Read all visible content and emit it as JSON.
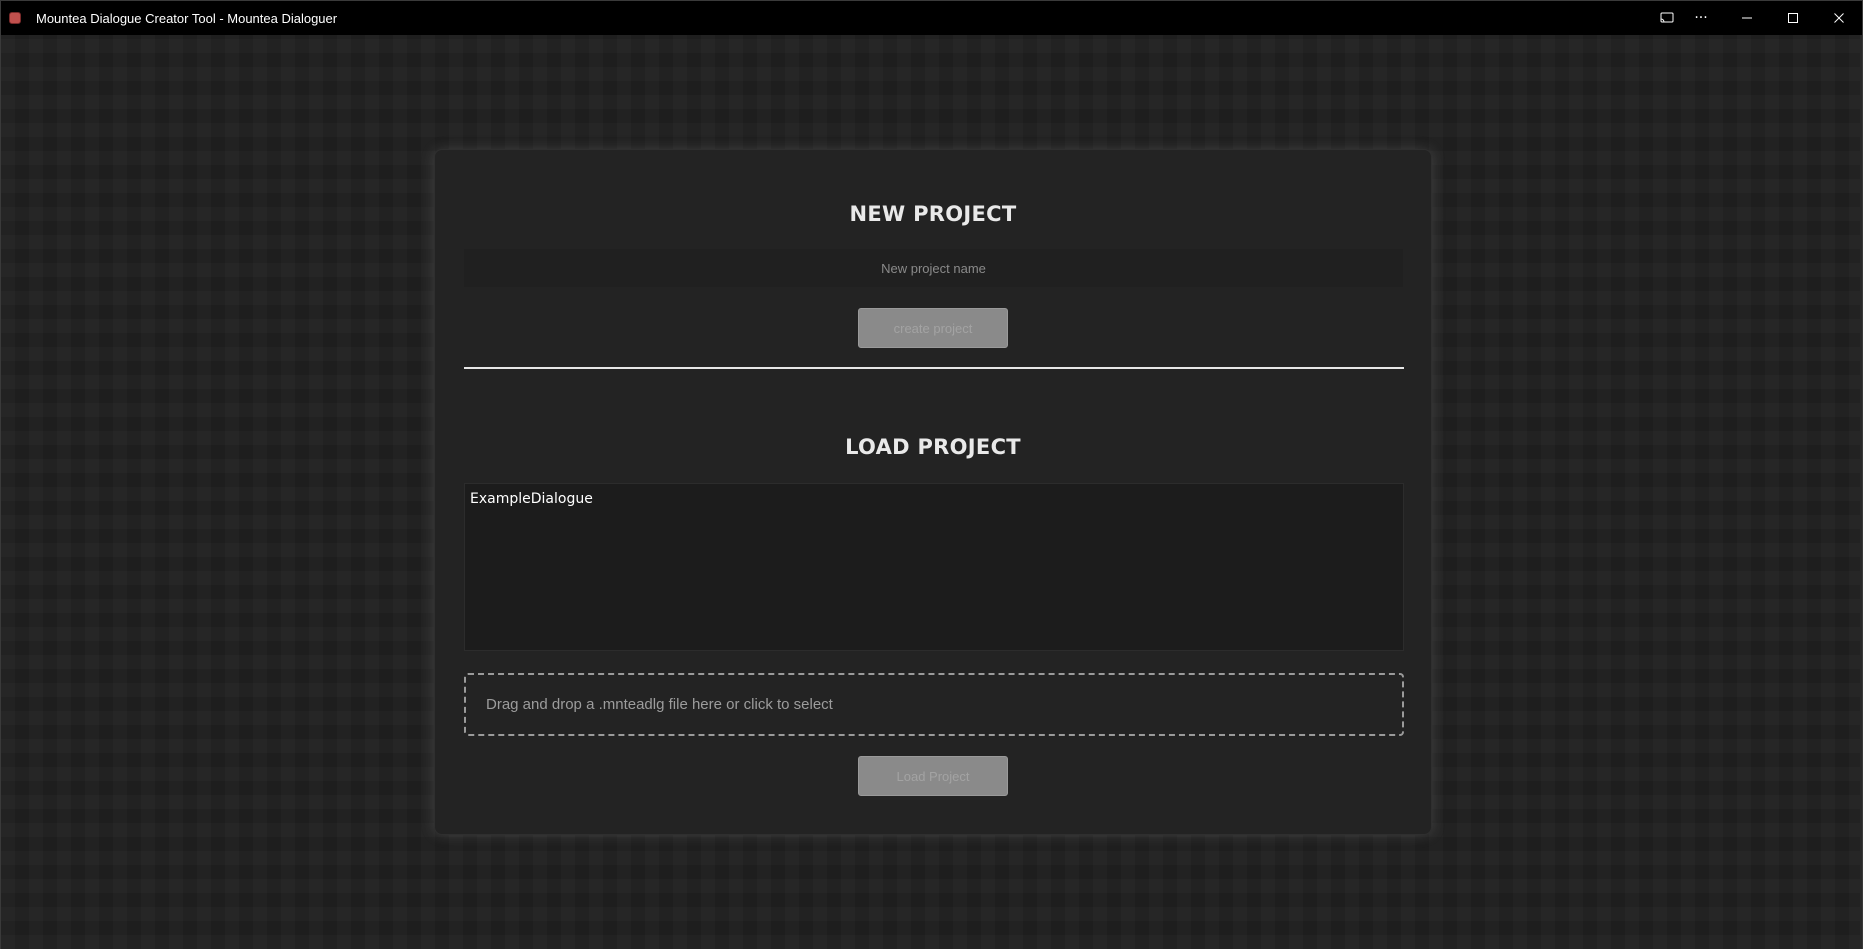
{
  "window": {
    "title": "Mountea Dialogue Creator Tool - Mountea Dialoguer",
    "controls": {
      "cast": "⧉",
      "more": "···",
      "minimize": "—",
      "maximize": "☐",
      "close": "✕"
    }
  },
  "new_project": {
    "heading": "NEW PROJECT",
    "name_placeholder": "New project name",
    "name_value": "",
    "create_label": "create project"
  },
  "load_project": {
    "heading": "LOAD PROJECT",
    "projects": [
      "ExampleDialogue"
    ],
    "dropzone_text": "Drag and drop a .mnteadlg file here or click to select",
    "load_label": "Load Project"
  },
  "colors": {
    "background": "#1e1e1e",
    "card": "#232323",
    "button_disabled": "#8a8a8a",
    "divider": "#e6e6e6"
  }
}
